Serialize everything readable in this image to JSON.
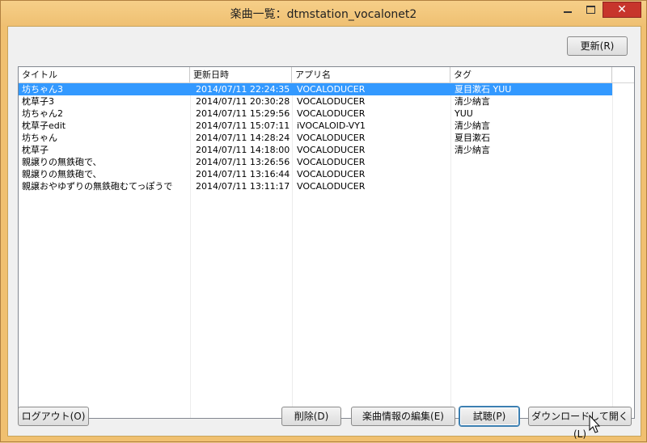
{
  "window": {
    "title": "楽曲一覧：dtmstation_vocalonet2"
  },
  "toolbar": {
    "refresh_label": "更新(R)"
  },
  "table": {
    "headers": [
      "タイトル",
      "更新日時",
      "アプリ名",
      "タグ"
    ],
    "rows": [
      [
        "坊ちゃん3",
        "2014/07/11 22:24:35",
        "VOCALODUCER",
        "夏目漱石 YUU"
      ],
      [
        "枕草子3",
        "2014/07/11 20:30:28",
        "VOCALODUCER",
        "清少納言"
      ],
      [
        "坊ちゃん2",
        "2014/07/11 15:29:56",
        "VOCALODUCER",
        "YUU"
      ],
      [
        "枕草子edit",
        "2014/07/11 15:07:11",
        "iVOCALOID-VY1",
        "清少納言"
      ],
      [
        "坊ちゃん",
        "2014/07/11 14:28:24",
        "VOCALODUCER",
        "夏目漱石"
      ],
      [
        "枕草子",
        "2014/07/11 14:18:00",
        "VOCALODUCER",
        "清少納言"
      ],
      [
        "親譲りの無鉄砲で、",
        "2014/07/11 13:26:56",
        "VOCALODUCER",
        ""
      ],
      [
        "親譲りの無鉄砲で、",
        "2014/07/11 13:16:44",
        "VOCALODUCER",
        ""
      ],
      [
        "親譲おやゆずりの無鉄砲むてっぽうで",
        "2014/07/11 13:11:17",
        "VOCALODUCER",
        ""
      ]
    ]
  },
  "footer": {
    "logout_label": "ログアウト(O)",
    "delete_label": "削除(D)",
    "edit_info_label": "楽曲情報の編集(E)",
    "preview_label": "試聴(P)",
    "download_open_label": "ダウンロードして開く(L)"
  },
  "icons": {
    "minimize": "minimize-icon",
    "maximize": "maximize-icon",
    "close": "close-icon",
    "close_glyph": "✕"
  },
  "colors": {
    "titlebar": "#f0c070",
    "selection": "#3399ff",
    "close": "#c7352c"
  }
}
